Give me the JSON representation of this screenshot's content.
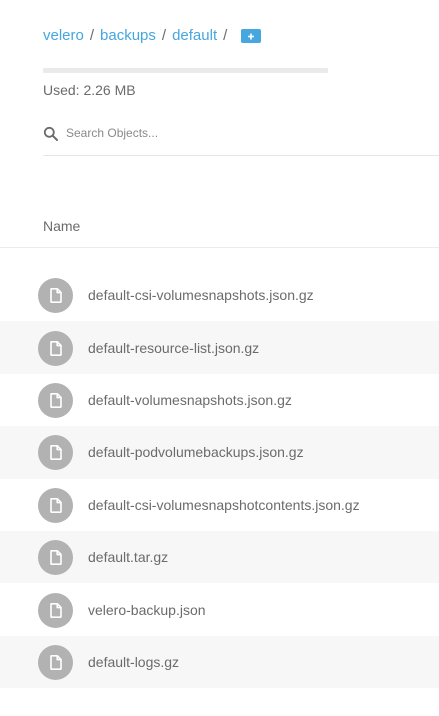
{
  "breadcrumb": {
    "items": [
      "velero",
      "backups",
      "default"
    ],
    "separator": "/"
  },
  "usage": {
    "label": "Used: 2.26 MB",
    "fill_fraction": 0.0
  },
  "search": {
    "placeholder": "Search Objects..."
  },
  "table": {
    "name_header": "Name"
  },
  "files": [
    {
      "name": "default-csi-volumesnapshots.json.gz",
      "icon": "file-icon"
    },
    {
      "name": "default-resource-list.json.gz",
      "icon": "file-icon"
    },
    {
      "name": "default-volumesnapshots.json.gz",
      "icon": "file-icon"
    },
    {
      "name": "default-podvolumebackups.json.gz",
      "icon": "file-icon"
    },
    {
      "name": "default-csi-volumesnapshotcontents.json.gz",
      "icon": "file-icon"
    },
    {
      "name": "default.tar.gz",
      "icon": "file-icon"
    },
    {
      "name": "velero-backup.json",
      "icon": "file-icon"
    },
    {
      "name": "default-logs.gz",
      "icon": "file-icon"
    }
  ],
  "colors": {
    "accent": "#46a6e0",
    "file_icon_bg": "#b2b2b2",
    "row_alt": "#f7f7f7"
  }
}
